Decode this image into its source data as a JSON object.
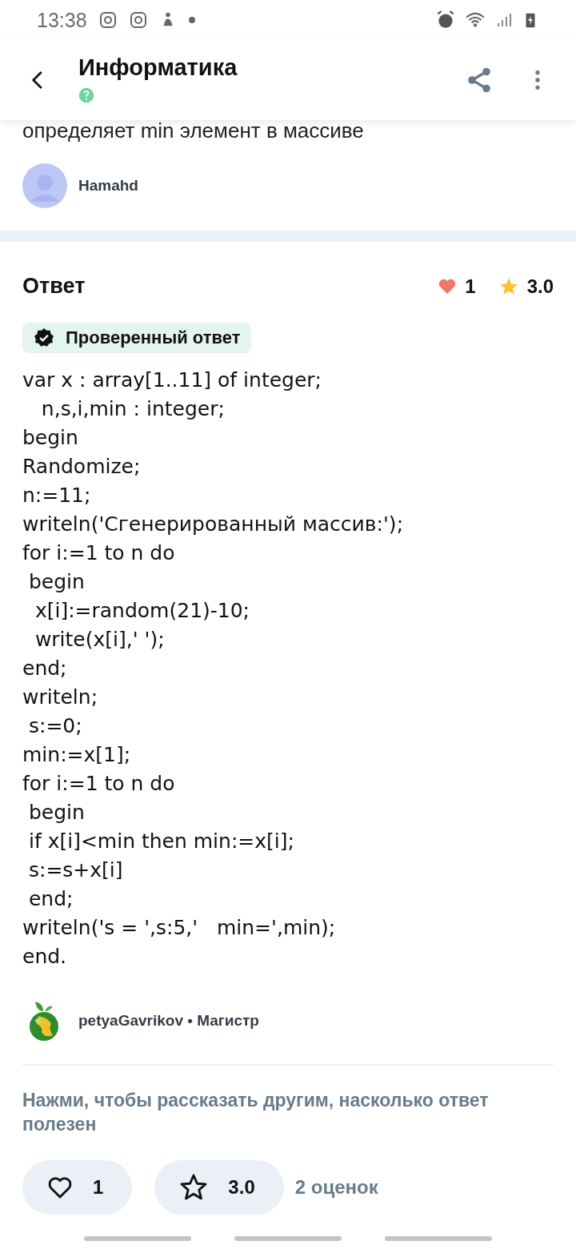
{
  "status_bar": {
    "time": "13:38"
  },
  "header": {
    "title": "Информатика"
  },
  "question": {
    "text_tail": "определяет min элемент в массиве",
    "author": "Hamahd"
  },
  "answer": {
    "title": "Ответ",
    "likes": "1",
    "rating": "3.0",
    "verified": true,
    "verified_label": "Проверенный ответ",
    "code_lines": [
      "var x : array[1..11] of integer;",
      "   n,s,i,min : integer;",
      "begin",
      "Randomize;",
      "n:=11;",
      "writeln('Сгенерированный массив:');",
      "for i:=1 to n do",
      " begin",
      "  x[i]:=random(21)-10;",
      "  write(x[i],' ');",
      "end;",
      "writeln;",
      " s:=0;",
      "min:=x[1];",
      "for i:=1 to n do",
      " begin",
      " if x[i]<min then min:=x[i];",
      " s:=s+x[i]",
      " end;",
      "writeln('s = ',s:5,'   min=',min);",
      "end."
    ],
    "author": "petyaGavrikov",
    "separator": "•",
    "rank": "Магистр",
    "prompt": "Нажми, чтобы рассказать другим, насколько ответ полезен",
    "like_button": {
      "count": "1"
    },
    "rate_button": {
      "value": "3.0"
    },
    "ratings_count": "2 оценок"
  }
}
